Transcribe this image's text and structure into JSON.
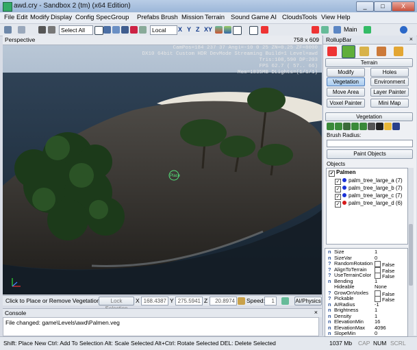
{
  "window": {
    "title": "awd.cry - Sandbox 2 (tm) (x64 Edition)",
    "min": "_",
    "max": "□",
    "close": "X"
  },
  "menu": [
    "File",
    "Edit",
    "Modify",
    "Display",
    "Config Spec",
    "Group",
    "Prefabs",
    "Brush",
    "Mission",
    "Terrain",
    "Sound",
    "Game",
    "AI",
    "Clouds",
    "Tools",
    "View",
    "Help"
  ],
  "toolbar": {
    "selection_filter": "Select All",
    "coord_system": "Local",
    "axes": [
      "X",
      "Y",
      "Z",
      "XY"
    ],
    "layer": "Main"
  },
  "viewport": {
    "name": "Perspective",
    "resolution": "758 x 609",
    "stats": [
      "CamPos=184 237  37 Angl=-10  0  25 ZN=0.25 ZF=8000",
      "DX10 64bit Custom HDR DevMode Streaming Build=1 Level=awd",
      "Tris:108,590  DP:203",
      "FPS  62.7 ( 57.. 66)",
      "Mem=1835MB DLights=(1/1/1)"
    ],
    "cursor_label": "Place"
  },
  "viewbar": {
    "prompt": "Click to Place or Remove Vegetation",
    "lock_selection": "Lock Selection",
    "x_label": "X",
    "x": "168.4387",
    "y_label": "Y",
    "y": "275.5941",
    "z_label": "Z",
    "z": "20.8974",
    "speed_label": "Speed:",
    "speed": "1",
    "ai_physics": "AI/Physics"
  },
  "console": {
    "title": "Console",
    "message": "File changed: game\\Levels\\awd\\Palmen.veg"
  },
  "status": {
    "hint": "Shift: Place New  Ctrl: Add To Selection  Alt: Scale Selected  Alt+Ctrl: Rotate Selected DEL: Delete Selected",
    "memory": "1037 Mb",
    "cap": "CAP",
    "num": "NUM",
    "scrl": "SCRL"
  },
  "rollup": {
    "title": "RollupBar",
    "terrain_header": "Terrain",
    "buttons": [
      "Modify",
      "Holes",
      "Vegetation",
      "Environment",
      "Move Area",
      "Layer Painter",
      "Voxel Painter",
      "Mini Map"
    ],
    "vegetation_header": "Vegetation",
    "brush_radius_label": "Brush Radius:",
    "paint_objects": "Paint Objects",
    "objects_label": "Objects",
    "group": "Palmen",
    "objects": [
      {
        "name": "palm_tree_large_a (7)",
        "color": "#1a32d6"
      },
      {
        "name": "palm_tree_large_b (7)",
        "color": "#1a32d6"
      },
      {
        "name": "palm_tree_large_c (7)",
        "color": "#1a32d6"
      },
      {
        "name": "palm_tree_large_d (6)",
        "color": "#d61a1a"
      }
    ],
    "properties": [
      {
        "icon": "n",
        "name": "Size",
        "value": "1"
      },
      {
        "icon": "n",
        "name": "SizeVar",
        "value": "0"
      },
      {
        "icon": "?",
        "name": "RandomRotation",
        "value": "False",
        "check": true
      },
      {
        "icon": "?",
        "name": "AlignToTerrain",
        "value": "False",
        "check": true
      },
      {
        "icon": "?",
        "name": "UseTerrainColor",
        "value": "False",
        "check": true
      },
      {
        "icon": "n",
        "name": "Bending",
        "value": "1"
      },
      {
        "icon": "",
        "name": "Hideable",
        "value": "None"
      },
      {
        "icon": "?",
        "name": "GrowOnVoxles",
        "value": "False",
        "check": true
      },
      {
        "icon": "?",
        "name": "Pickable",
        "value": "False",
        "check": true
      },
      {
        "icon": "n",
        "name": "AIRadius",
        "value": "-1"
      },
      {
        "icon": "n",
        "name": "Brightness",
        "value": "1"
      },
      {
        "icon": "n",
        "name": "Density",
        "value": "1"
      },
      {
        "icon": "n",
        "name": "ElevationMin",
        "value": "16"
      },
      {
        "icon": "n",
        "name": "ElevationMax",
        "value": "4096"
      },
      {
        "icon": "n",
        "name": "SlopeMin",
        "value": "0"
      }
    ]
  },
  "colors": {
    "accent": "#4a7bbb",
    "sand": "#e8e4da",
    "ocean": "#3f5a73"
  }
}
